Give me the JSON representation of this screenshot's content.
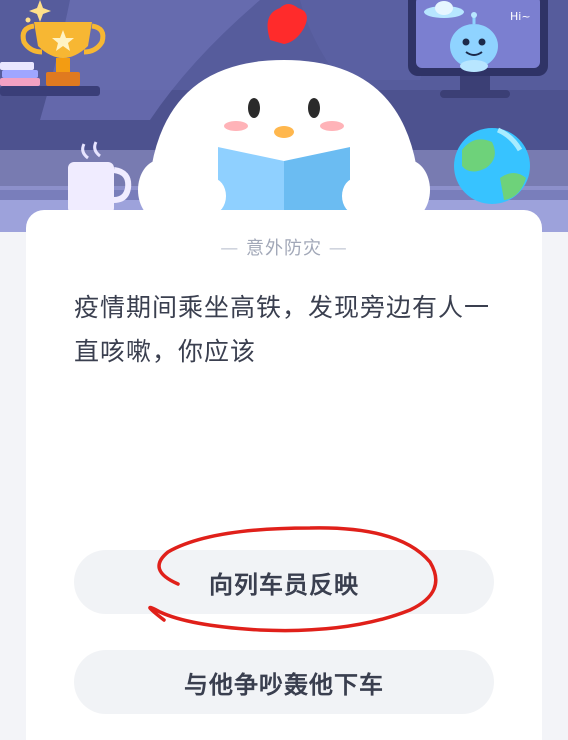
{
  "quiz": {
    "category": "意外防灾",
    "question": "疫情期间乘坐高铁，发现旁边有人一直咳嗽，你应该",
    "options": [
      {
        "label": "向列车员反映",
        "circled": true
      },
      {
        "label": "与他争吵轰他下车",
        "circled": false
      }
    ]
  },
  "banner": {
    "robot_speech": "Hi~"
  },
  "colors": {
    "banner_bg": "#4b4f8d",
    "card_bg": "#ffffff",
    "option_bg": "#f1f3f6",
    "text": "#3a3f4f",
    "category_text": "#a2a8b8",
    "annotation_red": "#e0201a"
  },
  "icons": [
    "trophy-icon",
    "mug-icon",
    "globe-icon",
    "chick-mascot",
    "robot-icon",
    "ufo-icon",
    "sparkle-icon"
  ]
}
